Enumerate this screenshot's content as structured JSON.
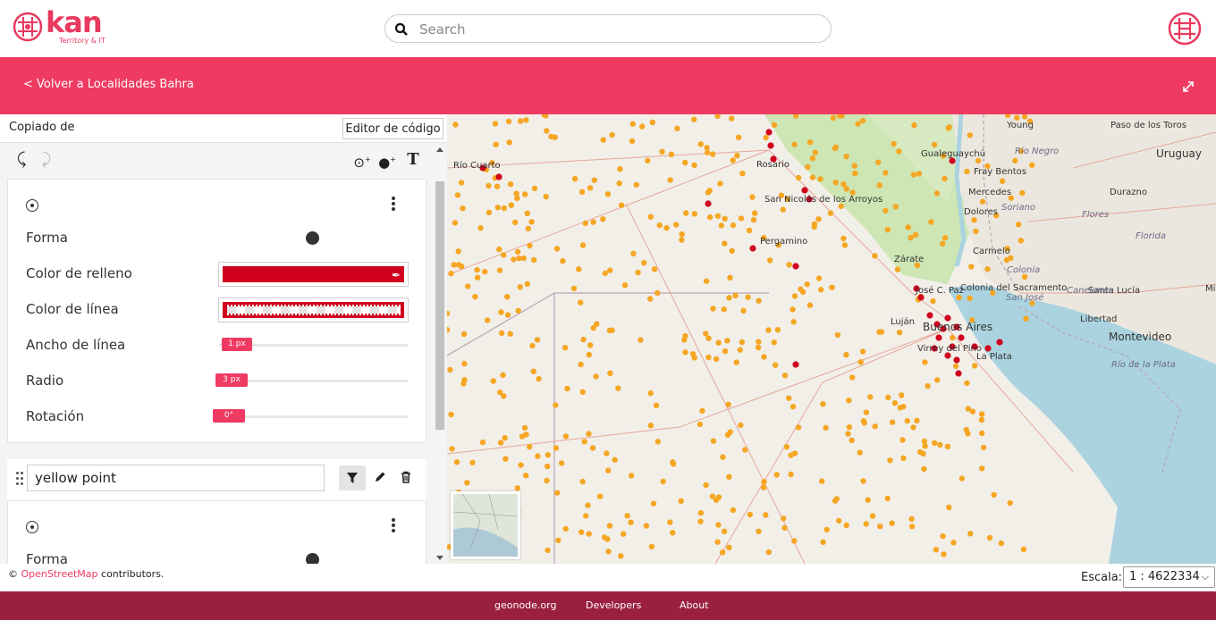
{
  "header": {
    "brand_name": "kan",
    "brand_tagline": "Territory & IT",
    "search_placeholder": "Search"
  },
  "banner": {
    "back_link": "< Volver a Localidades Bahra"
  },
  "style_editor": {
    "copied_from_label": "Copiado de",
    "code_editor_button": "Editor de código",
    "rule1": {
      "shape_label": "Forma",
      "fill_color_label": "Color de relleno",
      "fill_color": "#d0001e",
      "line_color_label": "Color de línea",
      "line_color": "#d0001e",
      "line_width_label": "Ancho de línea",
      "line_width_value": "1 px",
      "radius_label": "Radio",
      "radius_value": "3 px",
      "rotation_label": "Rotación",
      "rotation_value": "0°"
    },
    "rule2": {
      "name": "yellow point",
      "shape_label": "Forma"
    }
  },
  "map": {
    "place_labels": [
      "Río Cuarto",
      "Rosario",
      "San Nicolás de los Arroyos",
      "Pergamino",
      "Zárate",
      "Luján",
      "José C. Paz",
      "Buenos Aires",
      "Virrey del Pino",
      "La Plata",
      "Young",
      "Paso de los Toros",
      "Gualeguaychú",
      "Río Negro",
      "Uruguay",
      "Fray Bentos",
      "Mercedes",
      "Dolores",
      "Soriano",
      "Durazno",
      "Flores",
      "Florida",
      "Carmelo",
      "Colonia",
      "Colonia del Sacramento",
      "San José",
      "Santa Lucía",
      "Canelones",
      "Libertad",
      "Montevideo",
      "Río de la Plata",
      "Mi"
    ],
    "attribution_prefix": "© ",
    "attribution_link": "OpenStreetMap",
    "attribution_suffix": " contributors.",
    "scale_label": "Escala:",
    "scale_value": "1 : 4622334",
    "colors": {
      "yellow_points": "#f5a623",
      "red_points": "#d0001e",
      "water": "#aad3df",
      "land": "#f2efe9",
      "park": "#cde6b4"
    }
  },
  "footer": {
    "links": [
      "geonode.org",
      "Developers",
      "About"
    ]
  }
}
